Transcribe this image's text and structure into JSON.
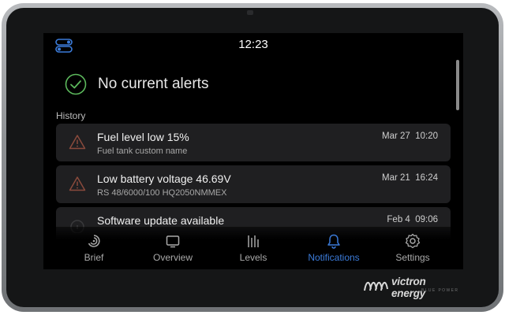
{
  "status_bar": {
    "time": "12:23",
    "menu_icon": "toggles-icon"
  },
  "alerts": {
    "status_text": "No current alerts",
    "icon": "check-circle-icon"
  },
  "history": {
    "heading": "History",
    "items": [
      {
        "title": "Fuel level low 15%",
        "subtitle": "Fuel tank custom name",
        "date": "Mar 27",
        "time": "10:20",
        "icon": "warning-icon"
      },
      {
        "title": "Low battery voltage 46.69V",
        "subtitle": "RS 48/6000/100 HQ2050NMMEX",
        "date": "Mar 21",
        "time": "16:24",
        "icon": "warning-icon"
      },
      {
        "title": "Software update available",
        "subtitle": "",
        "date": "Feb 4",
        "time": "09:06",
        "icon": "info-icon"
      }
    ]
  },
  "nav": {
    "active": "Notifications",
    "items": [
      {
        "label": "Brief",
        "icon": "brief-icon"
      },
      {
        "label": "Overview",
        "icon": "overview-icon"
      },
      {
        "label": "Levels",
        "icon": "levels-icon"
      },
      {
        "label": "Notifications",
        "icon": "bell-icon"
      },
      {
        "label": "Settings",
        "icon": "gear-icon"
      }
    ]
  },
  "brand": {
    "name": "victron energy",
    "tagline": "BLUE POWER"
  },
  "colors": {
    "accent": "#3b7bd9",
    "ok_green": "#5cb85c",
    "warning": "#8a4a3c",
    "card_bg": "#1f1f21"
  }
}
